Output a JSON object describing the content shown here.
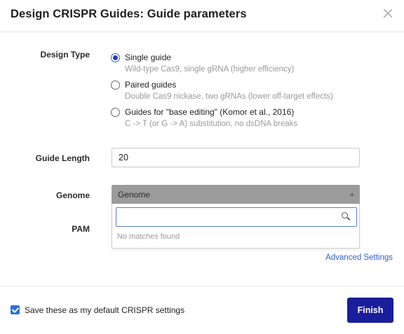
{
  "dialog": {
    "title": "Design CRISPR Guides: Guide parameters"
  },
  "design_type": {
    "label": "Design Type",
    "options": [
      {
        "label": "Single guide",
        "help": "Wild-type Cas9, single gRNA (higher efficiency)",
        "checked": true
      },
      {
        "label": "Paired guides",
        "help": "Double Cas9 nickase, two gRNAs (lower off-target effects)",
        "checked": false
      },
      {
        "label": "Guides for \"base editing\" (Komor et al., 2016)",
        "help": "C -> T (or G -> A) substitution, no dsDNA breaks",
        "checked": false
      }
    ]
  },
  "guide_length": {
    "label": "Guide Length",
    "value": "20"
  },
  "genome": {
    "label": "Genome",
    "selected": "Genome",
    "search_value": "",
    "no_matches": "No matches found"
  },
  "pam": {
    "label": "PAM"
  },
  "advanced_settings_link": "Advanced Settings",
  "footer": {
    "save_default_label": "Save these as my default CRISPR settings",
    "save_default_checked": true,
    "finish_label": "Finish"
  },
  "colors": {
    "primary_button": "#1a1e9a",
    "link": "#2f5fcf",
    "checkbox": "#2b6fd6"
  }
}
